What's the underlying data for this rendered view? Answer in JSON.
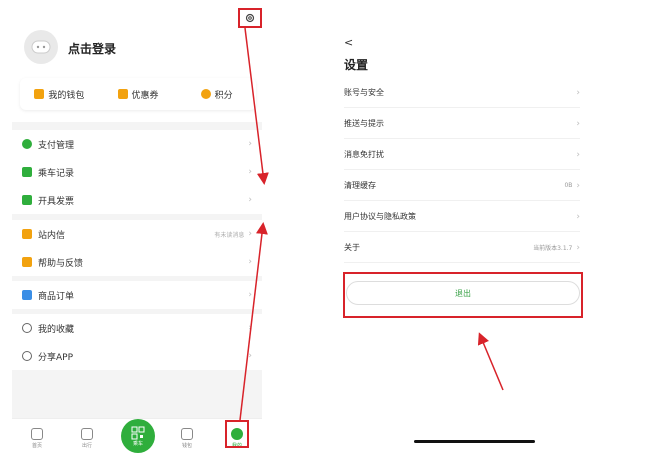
{
  "left": {
    "login_text": "点击登录",
    "quick": [
      {
        "label": "我的钱包",
        "color": "#f2a20f"
      },
      {
        "label": "优惠券",
        "color": "#f2a20f"
      },
      {
        "label": "积分",
        "color": "#f2a20f"
      }
    ],
    "group1": [
      {
        "label": "支付管理",
        "icon": "payment-icon",
        "color": "#2fae3c"
      },
      {
        "label": "乘车记录",
        "icon": "ride-record-icon",
        "color": "#2fae3c"
      },
      {
        "label": "开具发票",
        "icon": "invoice-icon",
        "color": "#2fae3c"
      }
    ],
    "group2": [
      {
        "label": "站内信",
        "sub": "有未读消息",
        "icon": "message-icon",
        "color": "#f2a20f"
      },
      {
        "label": "帮助与反馈",
        "icon": "help-icon",
        "color": "#f2a20f"
      }
    ],
    "group3": [
      {
        "label": "商品订单",
        "icon": "order-icon",
        "color": "#3a8ee6"
      }
    ],
    "group4": [
      {
        "label": "我的收藏",
        "icon": "star-icon",
        "color": "#666"
      },
      {
        "label": "分享APP",
        "icon": "share-icon",
        "color": "#666"
      }
    ],
    "tabs": [
      "首页",
      "出行",
      "乘车",
      "钱包",
      "我的"
    ]
  },
  "right": {
    "back": "<",
    "title": "设置",
    "rows": [
      {
        "label": "账号与安全",
        "sub": ""
      },
      {
        "label": "推送与提示",
        "sub": ""
      },
      {
        "label": "消息免打扰",
        "sub": ""
      },
      {
        "label": "清理缓存",
        "sub": "0B"
      },
      {
        "label": "用户协议与隐私政策",
        "sub": ""
      },
      {
        "label": "关于",
        "sub": "当前版本3.1.7"
      }
    ],
    "logout": "退出"
  },
  "colors": {
    "accent": "#2fae3c",
    "highlight": "#d8232a"
  }
}
